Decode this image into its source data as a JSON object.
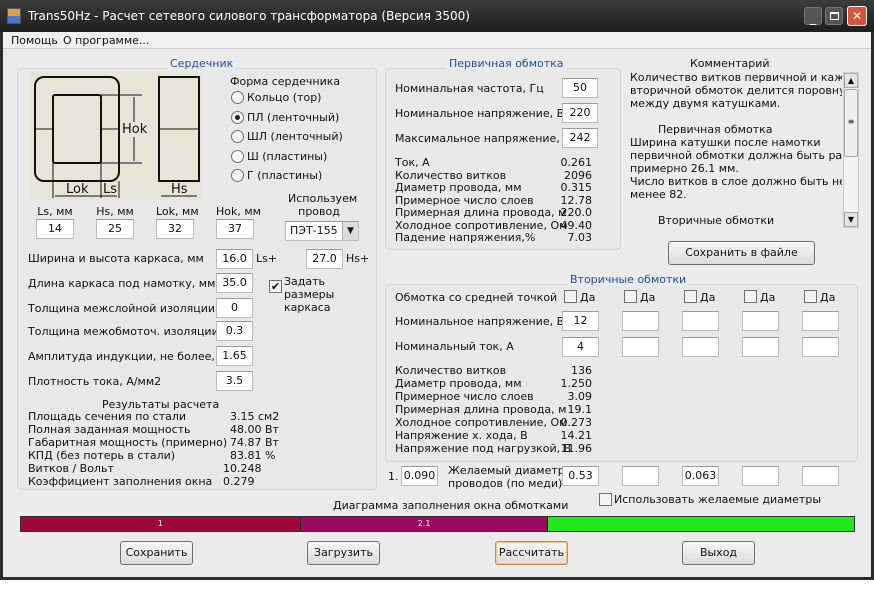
{
  "window": {
    "title": "Trans50Hz - Расчет сетевого силового трансформатора (Версия 3500)"
  },
  "menu": [
    "Помощь",
    "О программе..."
  ],
  "core": {
    "title": "Сердечник",
    "diagram": {
      "hok": "Hok",
      "lok": "Lok",
      "ls": "Ls",
      "hs": "Hs"
    },
    "shape_label": "Форма сердечника",
    "shapes": [
      {
        "label": "Кольцо  (тор)",
        "selected": false
      },
      {
        "label": "ПЛ  (ленточный)",
        "selected": true
      },
      {
        "label": "ШЛ  (ленточный)",
        "selected": false
      },
      {
        "label": "Ш  (пластины)",
        "selected": false
      },
      {
        "label": "Г (пластины)",
        "selected": false
      }
    ],
    "dims": [
      {
        "label": "Ls, мм",
        "value": "14"
      },
      {
        "label": "Hs, мм",
        "value": "25"
      },
      {
        "label": "Lok, мм",
        "value": "32"
      },
      {
        "label": "Hok, мм",
        "value": "37"
      }
    ],
    "wire_label": "Используем провод",
    "wire_value": "ПЭТ-155",
    "frame_wh_label": "Ширина и высота каркаса, мм",
    "frame_w": "16.0",
    "ls_plus": "Ls+",
    "frame_h": "27.0",
    "hs_plus": "Hs+",
    "frame_len_label": "Длина каркаса под намотку, мм",
    "frame_len": "35.0",
    "set_frame_label": "Задать размеры каркаса",
    "set_frame_checked": true,
    "interlayer_label": "Толщина межслойной изоляции, мм",
    "interlayer": "0",
    "interwinding_label": "Толщина межобмоточ. изоляции, мм",
    "interwinding": "0.3",
    "induction_label": "Амплитуда индукции, не более, Тл",
    "induction": "1.65",
    "current_density_label": "Плотность тока, А/мм2",
    "current_density": "3.5",
    "results_title": "Результаты расчета",
    "results": [
      {
        "label": "Площадь сечения по стали",
        "value": "3.15 см2"
      },
      {
        "label": "Полная заданная мощность",
        "value": "48.00 Вт"
      },
      {
        "label": "Габаритная мощность (примерно)",
        "value": "74.87 Вт"
      },
      {
        "label": "КПД (без потерь в стали)",
        "value": "83.81 %"
      },
      {
        "label": "Витков / Вольт",
        "value": "10.248"
      },
      {
        "label": "Коэффициент заполнения окна",
        "value": "0.279"
      }
    ]
  },
  "primary": {
    "title": "Первичная обмотка",
    "inputs": [
      {
        "label": "Номинальная частота, Гц",
        "value": "50"
      },
      {
        "label": "Номинальное напряжение, В",
        "value": "220"
      },
      {
        "label": "Максимальное напряжение, В",
        "value": "242"
      }
    ],
    "results": [
      {
        "label": "Ток, А",
        "value": "0.261"
      },
      {
        "label": "Количество витков",
        "value": "2096"
      },
      {
        "label": "Диаметр провода, мм",
        "value": "0.315"
      },
      {
        "label": "Примерное число слоев",
        "value": "12.78"
      },
      {
        "label": "Примерная длина провода, м",
        "value": "220.0"
      },
      {
        "label": "Холодное сопротивление, Ом",
        "value": "49.40"
      },
      {
        "label": "Падение напряжения,%",
        "value": "7.03"
      }
    ]
  },
  "comment": {
    "title": "Комментарий",
    "lines": [
      "Количество витков первичной и каждой",
      "вторичной обмоток делится поровну",
      "между двумя катушками.",
      "",
      "        Первичная обмотка",
      "Ширина катушки после намотки",
      "первичной обмотки должна быть равна",
      "примерно 26.1 мм.",
      "Число витков в слое должно быть не",
      "менее 82.",
      "",
      "        Вторичные обмотки"
    ],
    "save_button": "Сохранить в файле"
  },
  "secondary": {
    "title": "Вторичные обмотки",
    "center_tap_label": "Обмотка со средней точкой",
    "yes": "Да",
    "voltage_label": "Номинальное напряжение, В",
    "current_label": "Номинальный ток, А",
    "windings": [
      {
        "center_tap": false,
        "voltage": "12",
        "current": "4",
        "desired": "0.53"
      },
      {
        "center_tap": false,
        "voltage": "",
        "current": "",
        "desired": ""
      },
      {
        "center_tap": false,
        "voltage": "",
        "current": "",
        "desired": "0.063"
      },
      {
        "center_tap": false,
        "voltage": "",
        "current": "",
        "desired": ""
      },
      {
        "center_tap": false,
        "voltage": "",
        "current": "",
        "desired": ""
      }
    ],
    "results": [
      {
        "label": "Количество витков",
        "value": "136"
      },
      {
        "label": "Диаметр провода, мм",
        "value": "1.250"
      },
      {
        "label": "Примерное число слоев",
        "value": "3.09"
      },
      {
        "label": "Примерная длина провода, м",
        "value": "19.1"
      },
      {
        "label": "Холодное сопротивление, Ом",
        "value": "0.273"
      },
      {
        "label": "Напряжение х. хода, В",
        "value": "14.21"
      },
      {
        "label": "Напряжение под нагрузкой, В",
        "value": "11.96"
      }
    ],
    "primary_index": "1.",
    "primary_desired": "0.090",
    "desired_label_1": "Желаемый диаметр",
    "desired_label_2": "проводов  (по меди)",
    "use_desired_label": "Использовать желаемые диаметры"
  },
  "fill": {
    "title": "Диаграмма заполнения окна обмотками",
    "segments": [
      {
        "label": "1",
        "fraction": 0.336,
        "color": "#a0063e"
      },
      {
        "label": "2.1",
        "fraction": 0.297,
        "color": "#a0065e"
      },
      {
        "label": "",
        "fraction": 0.367,
        "color": "#1ee81e"
      }
    ]
  },
  "buttons": {
    "save": "Сохранить",
    "load": "Загрузить",
    "calc": "Рассчитать",
    "exit": "Выход"
  }
}
